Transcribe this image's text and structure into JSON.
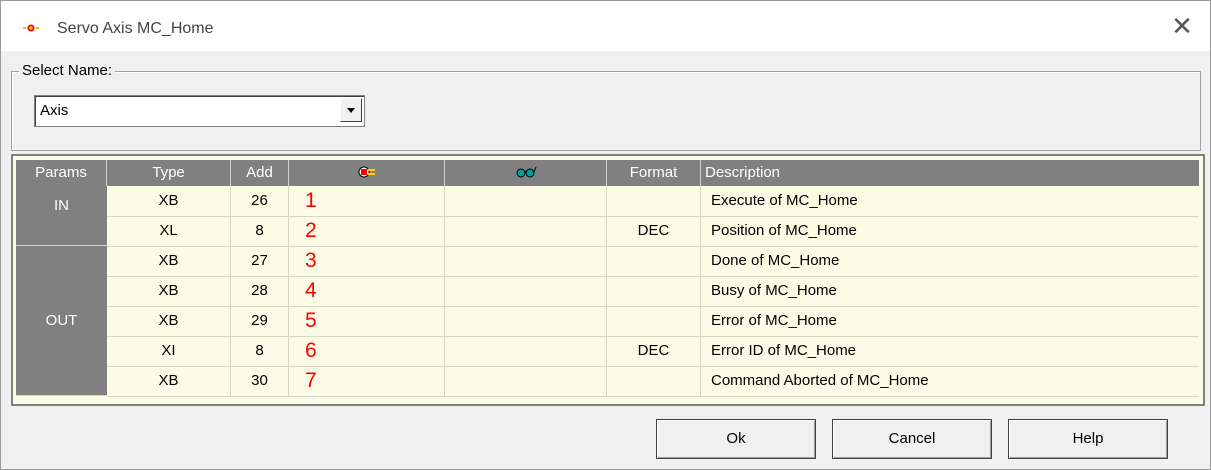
{
  "window": {
    "title": "Servo Axis MC_Home"
  },
  "select": {
    "legend": "Select Name:",
    "value": "Axis"
  },
  "grid": {
    "headers": {
      "params": "Params",
      "type": "Type",
      "add": "Add",
      "value_icon": "plug-icon",
      "watch_icon": "glasses-icon",
      "format": "Format",
      "description": "Description"
    },
    "groups": [
      {
        "label": "IN"
      },
      {
        "label": "OUT"
      }
    ],
    "rows": [
      {
        "type": "XB",
        "add": "26",
        "value": "1",
        "format": "",
        "description": "Execute of MC_Home"
      },
      {
        "type": "XL",
        "add": "8",
        "value": "2",
        "format": "DEC",
        "description": "Position of MC_Home"
      },
      {
        "type": "XB",
        "add": "27",
        "value": "3",
        "format": "",
        "description": "Done of MC_Home"
      },
      {
        "type": "XB",
        "add": "28",
        "value": "4",
        "format": "",
        "description": "Busy of MC_Home"
      },
      {
        "type": "XB",
        "add": "29",
        "value": "5",
        "format": "",
        "description": "Error of MC_Home"
      },
      {
        "type": "XI",
        "add": "8",
        "value": "6",
        "format": "DEC",
        "description": "Error ID of MC_Home"
      },
      {
        "type": "XB",
        "add": "30",
        "value": "7",
        "format": "",
        "description": "Command Aborted of MC_Home"
      }
    ]
  },
  "buttons": {
    "ok": "Ok",
    "cancel": "Cancel",
    "help": "Help"
  }
}
